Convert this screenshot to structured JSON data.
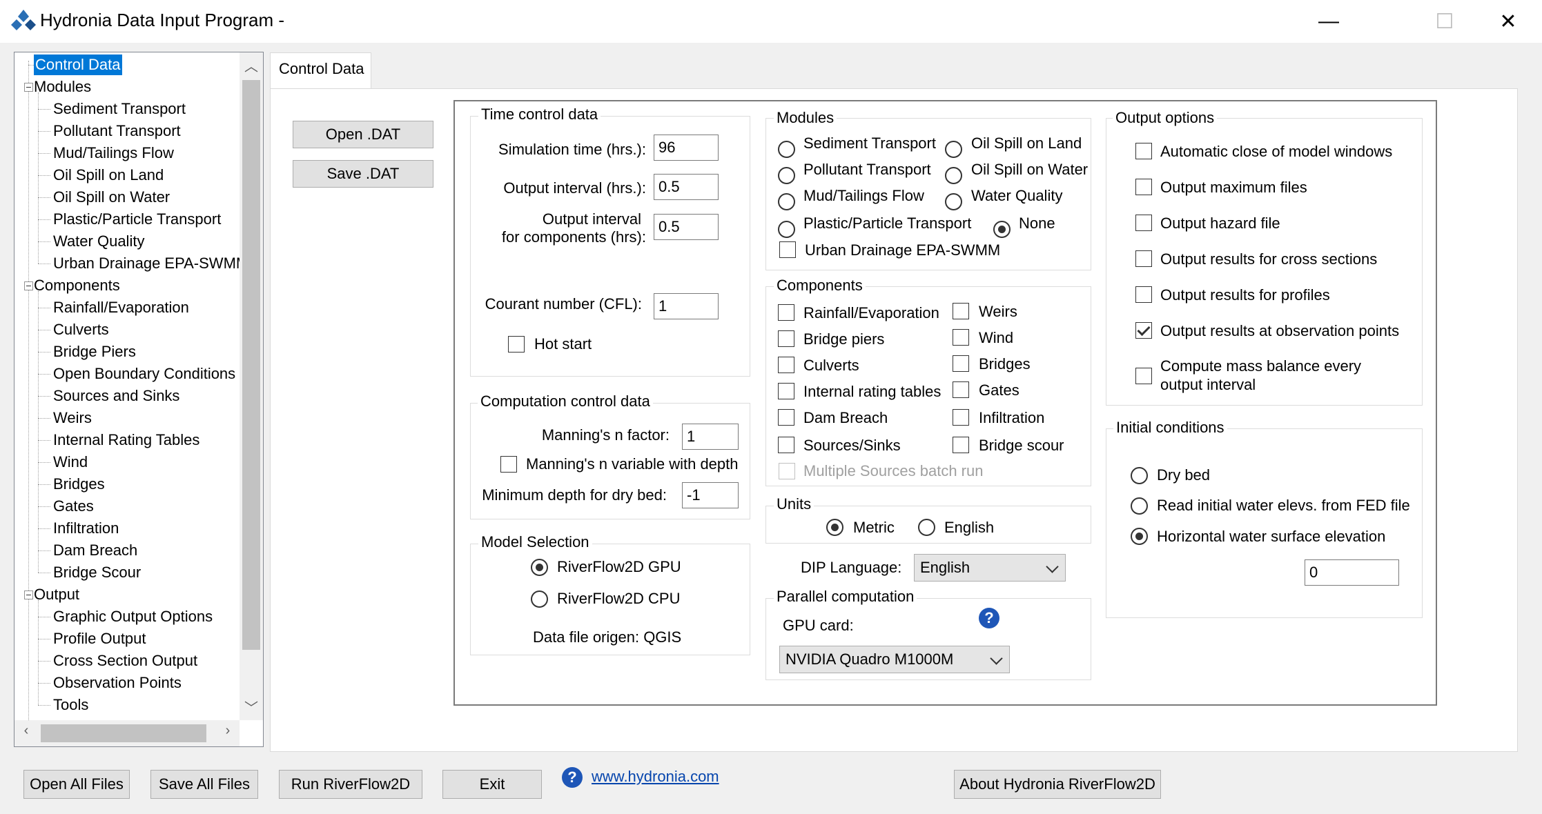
{
  "window": {
    "title": "Hydronia Data Input Program -",
    "minimize": "—",
    "maximize": "☐",
    "close": "✕"
  },
  "tree": {
    "items": [
      {
        "label": "Control Data",
        "level": 0,
        "selected": true,
        "expander": false
      },
      {
        "label": "Modules",
        "level": 0,
        "expander": true
      },
      {
        "label": "Sediment Transport",
        "level": 1
      },
      {
        "label": "Pollutant Transport",
        "level": 1
      },
      {
        "label": "Mud/Tailings Flow",
        "level": 1
      },
      {
        "label": "Oil Spill on Land",
        "level": 1
      },
      {
        "label": "Oil Spill on Water",
        "level": 1
      },
      {
        "label": "Plastic/Particle Transport",
        "level": 1
      },
      {
        "label": "Water Quality",
        "level": 1
      },
      {
        "label": "Urban Drainage EPA-SWMM",
        "level": 1
      },
      {
        "label": "Components",
        "level": 0,
        "expander": true
      },
      {
        "label": "Rainfall/Evaporation",
        "level": 1
      },
      {
        "label": "Culverts",
        "level": 1
      },
      {
        "label": "Bridge Piers",
        "level": 1
      },
      {
        "label": "Open Boundary Conditions",
        "level": 1
      },
      {
        "label": "Sources and Sinks",
        "level": 1
      },
      {
        "label": "Weirs",
        "level": 1
      },
      {
        "label": "Internal Rating Tables",
        "level": 1
      },
      {
        "label": "Wind",
        "level": 1
      },
      {
        "label": "Bridges",
        "level": 1
      },
      {
        "label": "Gates",
        "level": 1
      },
      {
        "label": "Infiltration",
        "level": 1
      },
      {
        "label": "Dam Breach",
        "level": 1
      },
      {
        "label": "Bridge Scour",
        "level": 1
      },
      {
        "label": "Output",
        "level": 0,
        "expander": true
      },
      {
        "label": "Graphic Output Options",
        "level": 1
      },
      {
        "label": "Profile Output",
        "level": 1
      },
      {
        "label": "Cross Section Output",
        "level": 1
      },
      {
        "label": "Observation Points",
        "level": 1
      },
      {
        "label": "Tools",
        "level": 1
      }
    ]
  },
  "tab": {
    "label": "Control Data"
  },
  "buttons": {
    "open_dat": "Open .DAT",
    "save_dat": "Save .DAT"
  },
  "time_control": {
    "title": "Time control data",
    "simulation_label": "Simulation time (hrs.):",
    "simulation_value": "96",
    "output_interval_label": "Output interval (hrs.):",
    "output_interval_value": "0.5",
    "comp_interval_label1": "Output interval",
    "comp_interval_label2": "for components (hrs):",
    "comp_interval_value": "0.5",
    "courant_label": "Courant number (CFL):",
    "courant_value": "1",
    "hot_start": "Hot start"
  },
  "computation": {
    "title": "Computation control data",
    "manning_label": "Manning's n factor:",
    "manning_value": "1",
    "manning_var": "Manning's n variable with depth",
    "min_depth_label": "Minimum depth for dry bed:",
    "min_depth_value": "-1"
  },
  "model_selection": {
    "title": "Model Selection",
    "gpu": "RiverFlow2D GPU",
    "cpu": "RiverFlow2D CPU",
    "origin": "Data file origen: QGIS"
  },
  "modules": {
    "title": "Modules",
    "left": [
      "Sediment Transport",
      "Pollutant Transport",
      "Mud/Tailings Flow",
      "Plastic/Particle Transport"
    ],
    "right": [
      "Oil Spill on Land",
      "Oil Spill on Water",
      "Water Quality",
      "None"
    ],
    "urban": "Urban Drainage EPA-SWMM"
  },
  "components": {
    "title": "Components",
    "left": [
      "Rainfall/Evaporation",
      "Bridge piers",
      "Culverts",
      "Internal rating tables",
      "Dam Breach",
      "Sources/Sinks"
    ],
    "right": [
      "Weirs",
      "Wind",
      "Bridges",
      "Gates",
      "Infiltration",
      "Bridge scour"
    ],
    "multiple": "Multiple Sources batch run"
  },
  "units": {
    "title": "Units",
    "metric": "Metric",
    "english": "English"
  },
  "dip": {
    "label": "DIP Language:",
    "value": "English"
  },
  "parallel": {
    "title": "Parallel computation",
    "gpu_label": "GPU card:",
    "gpu_value": "NVIDIA Quadro M1000M",
    "help": "?"
  },
  "output_options": {
    "title": "Output options",
    "items": [
      "Automatic close of model windows",
      "Output maximum files",
      "Output hazard file",
      "Output results for cross sections",
      "Output results for profiles",
      "Output results at observation points"
    ],
    "mass1": "Compute mass balance every",
    "mass2": "output interval"
  },
  "initial": {
    "title": "Initial conditions",
    "dry": "Dry bed",
    "read": "Read initial water elevs. from FED file",
    "horiz": "Horizontal water surface elevation",
    "value": "0"
  },
  "footer": {
    "open_all": "Open All Files",
    "save_all": "Save All Files",
    "run": "Run RiverFlow2D",
    "exit": "Exit",
    "help": "?",
    "link": "www.hydronia.com",
    "about": "About Hydronia RiverFlow2D"
  },
  "colors": {
    "selection": "#0078d7",
    "help_icon": "#1e56b7",
    "link": "#0645ad"
  }
}
